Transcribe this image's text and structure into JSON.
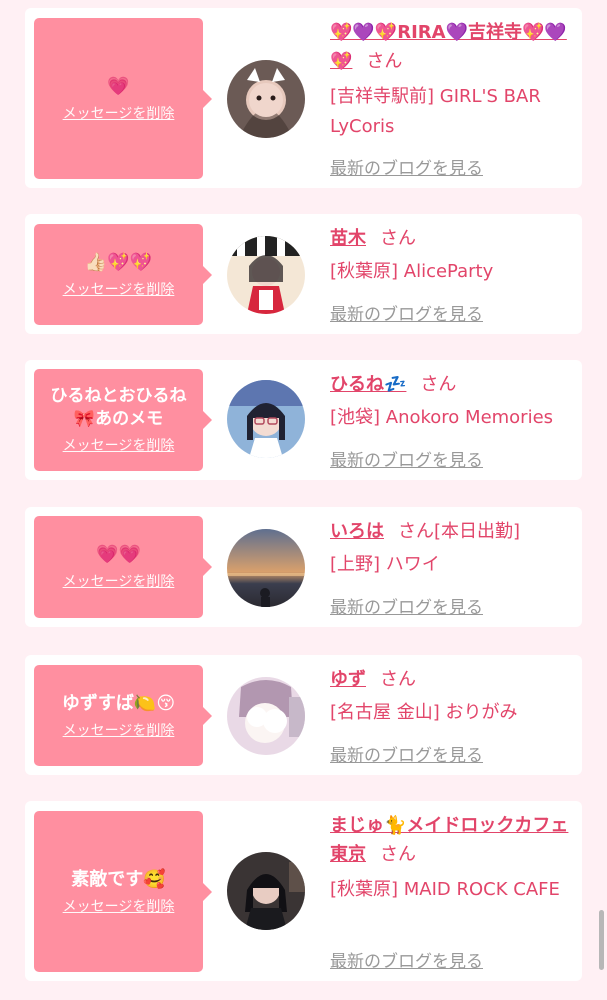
{
  "delete_label": "メッセージを削除",
  "blog_label": "最新のブログを見る",
  "san_label": "さん",
  "colors": {
    "page_bg": "#fff0f4",
    "bubble": "#ff8fa0",
    "accent_text": "#e2456a",
    "link_gray": "#999999"
  },
  "items": [
    {
      "message": "💗",
      "name": "💖💜💖RIRA💜吉祥寺💖💜💖",
      "shop": "[吉祥寺駅前] GIRL'S BAR LyCoris",
      "status": "",
      "avatar": "avatar-girl-cat-ears"
    },
    {
      "message": "👍🏻💖💖",
      "name": "苗木",
      "shop": "[秋葉原] AliceParty",
      "status": "",
      "avatar": "avatar-girl-costume"
    },
    {
      "message": "ひるねとおひるね🎀あのメモ",
      "name": "ひるね💤",
      "shop": "[池袋] Anokoro Memories",
      "status": "",
      "avatar": "avatar-girl-glasses"
    },
    {
      "message": "💗💗",
      "name": "いろは",
      "shop": "[上野] ハワイ",
      "status": "[本日出勤]",
      "avatar": "avatar-sunset-beach"
    },
    {
      "message": "ゆずすば🍋😚",
      "name": "ゆず",
      "shop": "[名古屋 金山] おりがみ",
      "status": "",
      "avatar": "avatar-girl-blurred"
    },
    {
      "message": "素敵です🥰",
      "name": "まじゅ🐈メイドロックカフェ東京",
      "shop": "[秋葉原] MAID ROCK CAFE",
      "status": "",
      "avatar": "avatar-girl-dark-hair"
    }
  ]
}
